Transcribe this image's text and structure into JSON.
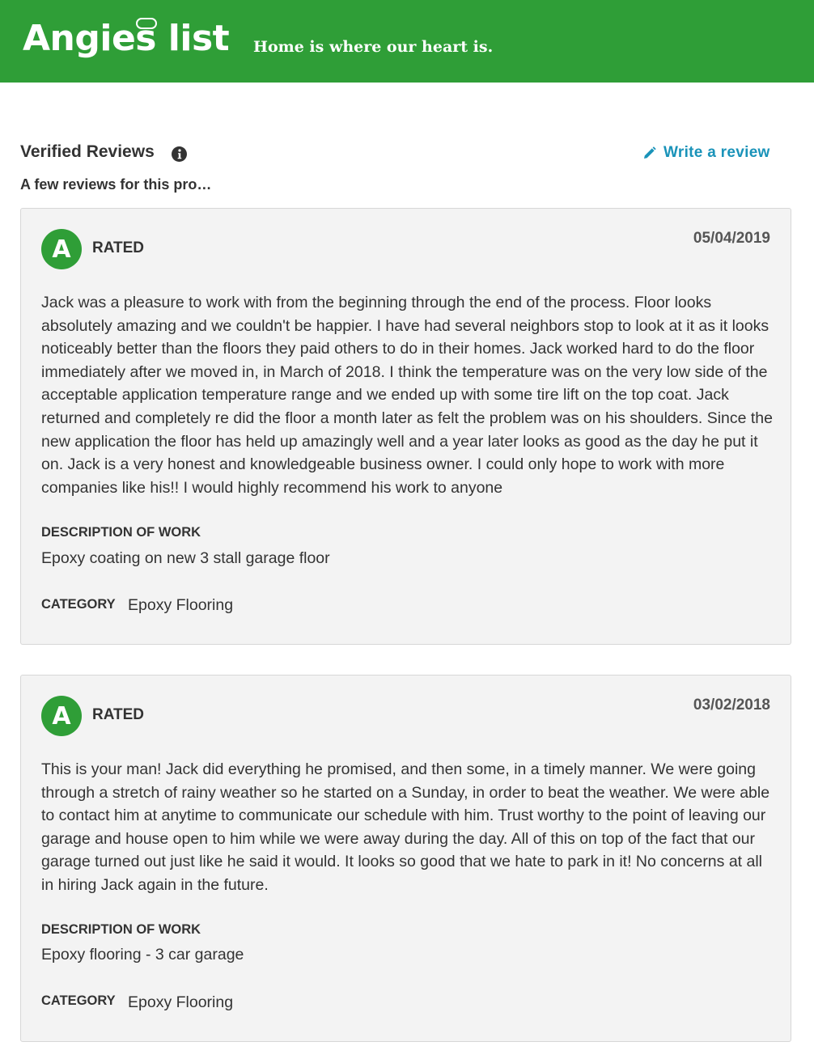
{
  "header": {
    "logo_text": "Angies list",
    "tagline": "Home is where our heart is.",
    "background_color": "#2f9e37"
  },
  "section": {
    "title": "Verified Reviews",
    "info_icon": "info-icon",
    "write_review_label": "Write a review",
    "write_review_icon": "pencil-icon",
    "subtitle": "A few reviews for this pro…"
  },
  "reviews": [
    {
      "grade": "A",
      "rated_label": "RATED",
      "date": "05/04/2019",
      "text": "Jack was a pleasure to work with from the beginning through the end of the process. Floor looks absolutely amazing and we couldn't be happier. I have had several neighbors stop to look at it as it looks noticeably better than the floors they paid others to do in their homes. Jack worked hard to do the floor immediately after we moved in, in March of 2018. I think the temperature was on the very low side of the acceptable application temperature range and we ended up with some tire lift on the top coat. Jack returned and completely re did the floor a month later as felt the problem was on his shoulders. Since the new application the floor has held up amazingly well and a year later looks as good as the day he put it on. Jack is a very honest and knowledgeable business owner. I could only hope to work with more companies like his!! I would highly recommend his work to anyone",
      "description_label": "DESCRIPTION OF WORK",
      "description": "Epoxy coating on new 3 stall garage floor",
      "category_label": "CATEGORY",
      "category": "Epoxy Flooring"
    },
    {
      "grade": "A",
      "rated_label": "RATED",
      "date": "03/02/2018",
      "text": "This is your man! Jack did everything he promised, and then some, in a timely manner. We were going through a stretch of rainy weather so he started on a Sunday, in order to beat the weather. We were able to contact him at anytime to communicate our schedule with him. Trust worthy to the point of leaving our garage and house open to him while we were away during the day. All of this on top of the fact that our garage turned out just like he said it would. It looks so good that we hate to park in it! No concerns at all in hiring Jack again in the future.",
      "description_label": "DESCRIPTION OF WORK",
      "description": "Epoxy flooring - 3 car garage",
      "category_label": "CATEGORY",
      "category": "Epoxy Flooring"
    }
  ],
  "colors": {
    "brand_green": "#2f9e37",
    "link_blue": "#1a93b9",
    "card_background": "#f3f3f3"
  }
}
